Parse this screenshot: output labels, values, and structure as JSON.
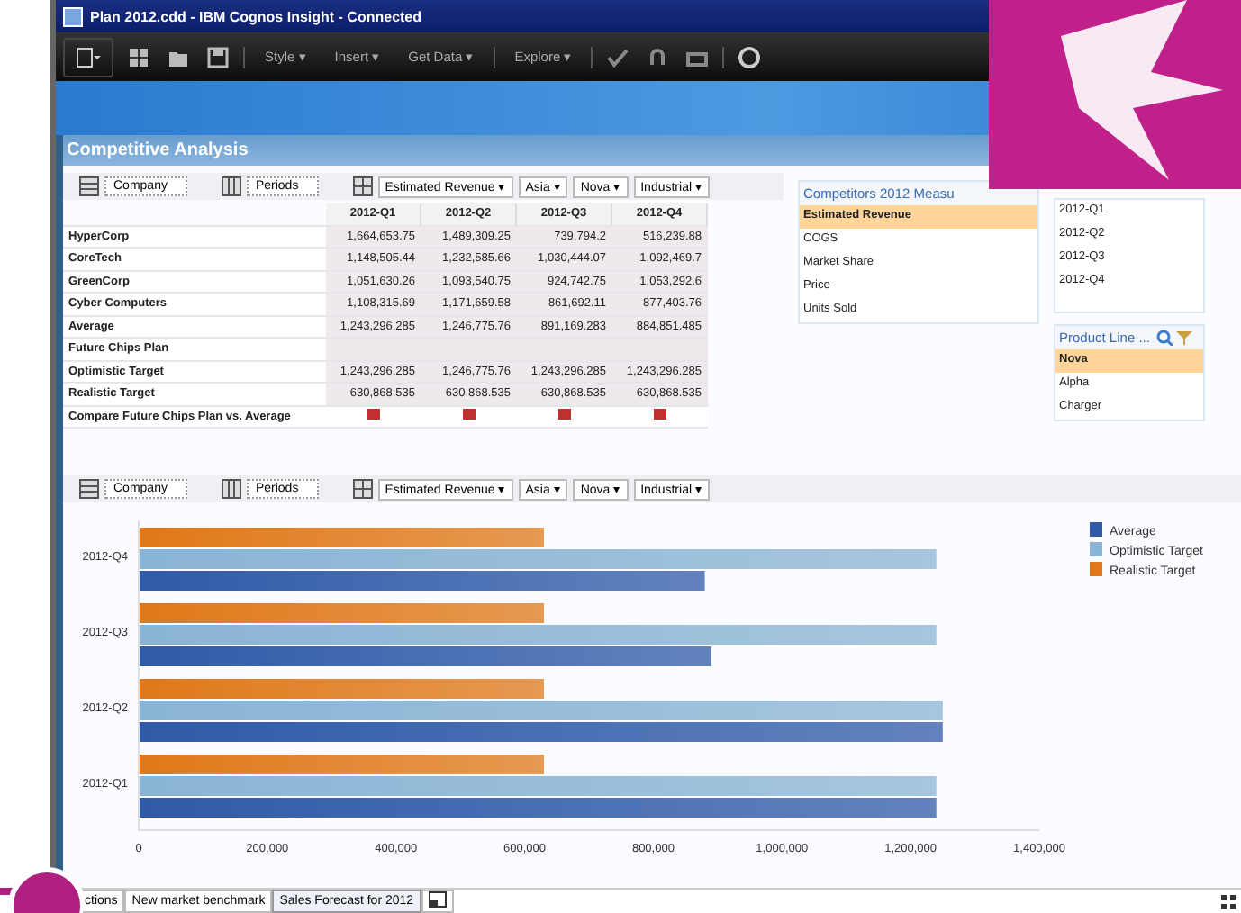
{
  "window": {
    "title": "Plan 2012.cdd - IBM Cognos Insight - Connected"
  },
  "toolbar": {
    "menus": [
      "Style ▾",
      "Insert ▾",
      "Get Data ▾",
      "Explore ▾"
    ]
  },
  "workspace": {
    "title": "Competitive Analysis"
  },
  "table_filters": [
    {
      "kind": "rows",
      "label": "Company"
    },
    {
      "kind": "columns",
      "label": "Periods"
    },
    {
      "kind": "context",
      "items": [
        "Estimated Revenue ▾",
        "Asia ▾",
        "Nova ▾",
        "Industrial ▾"
      ]
    }
  ],
  "table": {
    "columns": [
      "2012-Q1",
      "2012-Q2",
      "2012-Q3",
      "2012-Q4"
    ],
    "rows": [
      {
        "label": "HyperCorp",
        "cells": [
          "1,664,653.75",
          "1,489,309.25",
          "739,794.2",
          "516,239.88"
        ]
      },
      {
        "label": "CoreTech",
        "cells": [
          "1,148,505.44",
          "1,232,585.66",
          "1,030,444.07",
          "1,092,469.7"
        ]
      },
      {
        "label": "GreenCorp",
        "cells": [
          "1,051,630.26",
          "1,093,540.75",
          "924,742.75",
          "1,053,292.6"
        ]
      },
      {
        "label": "Cyber Computers",
        "cells": [
          "1,108,315.69",
          "1,171,659.58",
          "861,692.11",
          "877,403.76"
        ]
      },
      {
        "label": "Average",
        "cells": [
          "1,243,296.285",
          "1,246,775.76",
          "891,169.283",
          "884,851.485"
        ]
      },
      {
        "label": "Future Chips Plan",
        "cells": []
      },
      {
        "label": "Optimistic Target",
        "cells": [
          "1,243,296.285",
          "1,246,775.76",
          "1,243,296.285",
          "1,243,296.285"
        ]
      },
      {
        "label": "Realistic Target",
        "cells": [
          "630,868.535",
          "630,868.535",
          "630,868.535",
          "630,868.535"
        ]
      },
      {
        "label": "Compare Future Chips Plan vs. Average",
        "indicators": [
          {
            "color": "#c03030"
          },
          {
            "color": "#c03030"
          },
          {
            "color": "#c03030"
          },
          {
            "color": "#c03030"
          }
        ]
      }
    ]
  },
  "measures": {
    "title": "Competitors 2012 Measu",
    "items": [
      {
        "label": "Estimated Revenue",
        "selected": true
      },
      {
        "label": "COGS",
        "selected": false
      },
      {
        "label": "Market Share",
        "selected": false
      },
      {
        "label": "Price",
        "selected": false
      },
      {
        "label": "Units Sold",
        "selected": false
      }
    ]
  },
  "periods": {
    "items": [
      {
        "label": "2012-Q1",
        "selected": false
      },
      {
        "label": "2012-Q2",
        "selected": false
      },
      {
        "label": "2012-Q3",
        "selected": false
      },
      {
        "label": "2012-Q4",
        "selected": false
      }
    ]
  },
  "product_line": {
    "title": "Product Line ...",
    "items": [
      {
        "label": "Nova",
        "selected": true
      },
      {
        "label": "Alpha",
        "selected": false
      },
      {
        "label": "Charger",
        "selected": false
      }
    ]
  },
  "chart": {
    "filters": [
      {
        "kind": "rows",
        "label": "Company"
      },
      {
        "kind": "columns",
        "label": "Periods"
      },
      {
        "kind": "context",
        "items": [
          "Estimated Revenue ▾",
          "Asia ▾",
          "Nova ▾",
          "Industrial ▾"
        ]
      }
    ],
    "chart_data": {
      "type": "bar",
      "orientation": "horizontal",
      "legend": "right",
      "categories": [
        "2012-Q4",
        "2012-Q3",
        "2012-Q2",
        "2012-Q1"
      ],
      "series": [
        {
          "name": "Realistic Target",
          "color": "#e07818",
          "values": [
            630000,
            630000,
            630000,
            630000
          ]
        },
        {
          "name": "Optimistic Target",
          "color": "#8ab4d4",
          "values": [
            1240000,
            1240000,
            1250000,
            1240000
          ]
        },
        {
          "name": "Average",
          "color": "#2f5aa8",
          "values": [
            880000,
            890000,
            1250000,
            1240000
          ]
        }
      ],
      "xlim": [
        0,
        1400000
      ],
      "xticks": [
        {
          "value": 0,
          "label": "0"
        },
        {
          "value": 200000,
          "label": "200,000"
        },
        {
          "value": 400000,
          "label": "400,000"
        },
        {
          "value": 600000,
          "label": "600,000"
        },
        {
          "value": 800000,
          "label": "800,000"
        },
        {
          "value": 1000000,
          "label": "1,000,000"
        },
        {
          "value": 1200000,
          "label": "1,200,000"
        },
        {
          "value": 1400000,
          "label": "1,400,000"
        }
      ]
    }
  },
  "tabs": [
    {
      "label": "ctions",
      "selected": false
    },
    {
      "label": "New market benchmark",
      "selected": false
    },
    {
      "label": "Sales Forecast for 2012",
      "selected": true
    }
  ]
}
